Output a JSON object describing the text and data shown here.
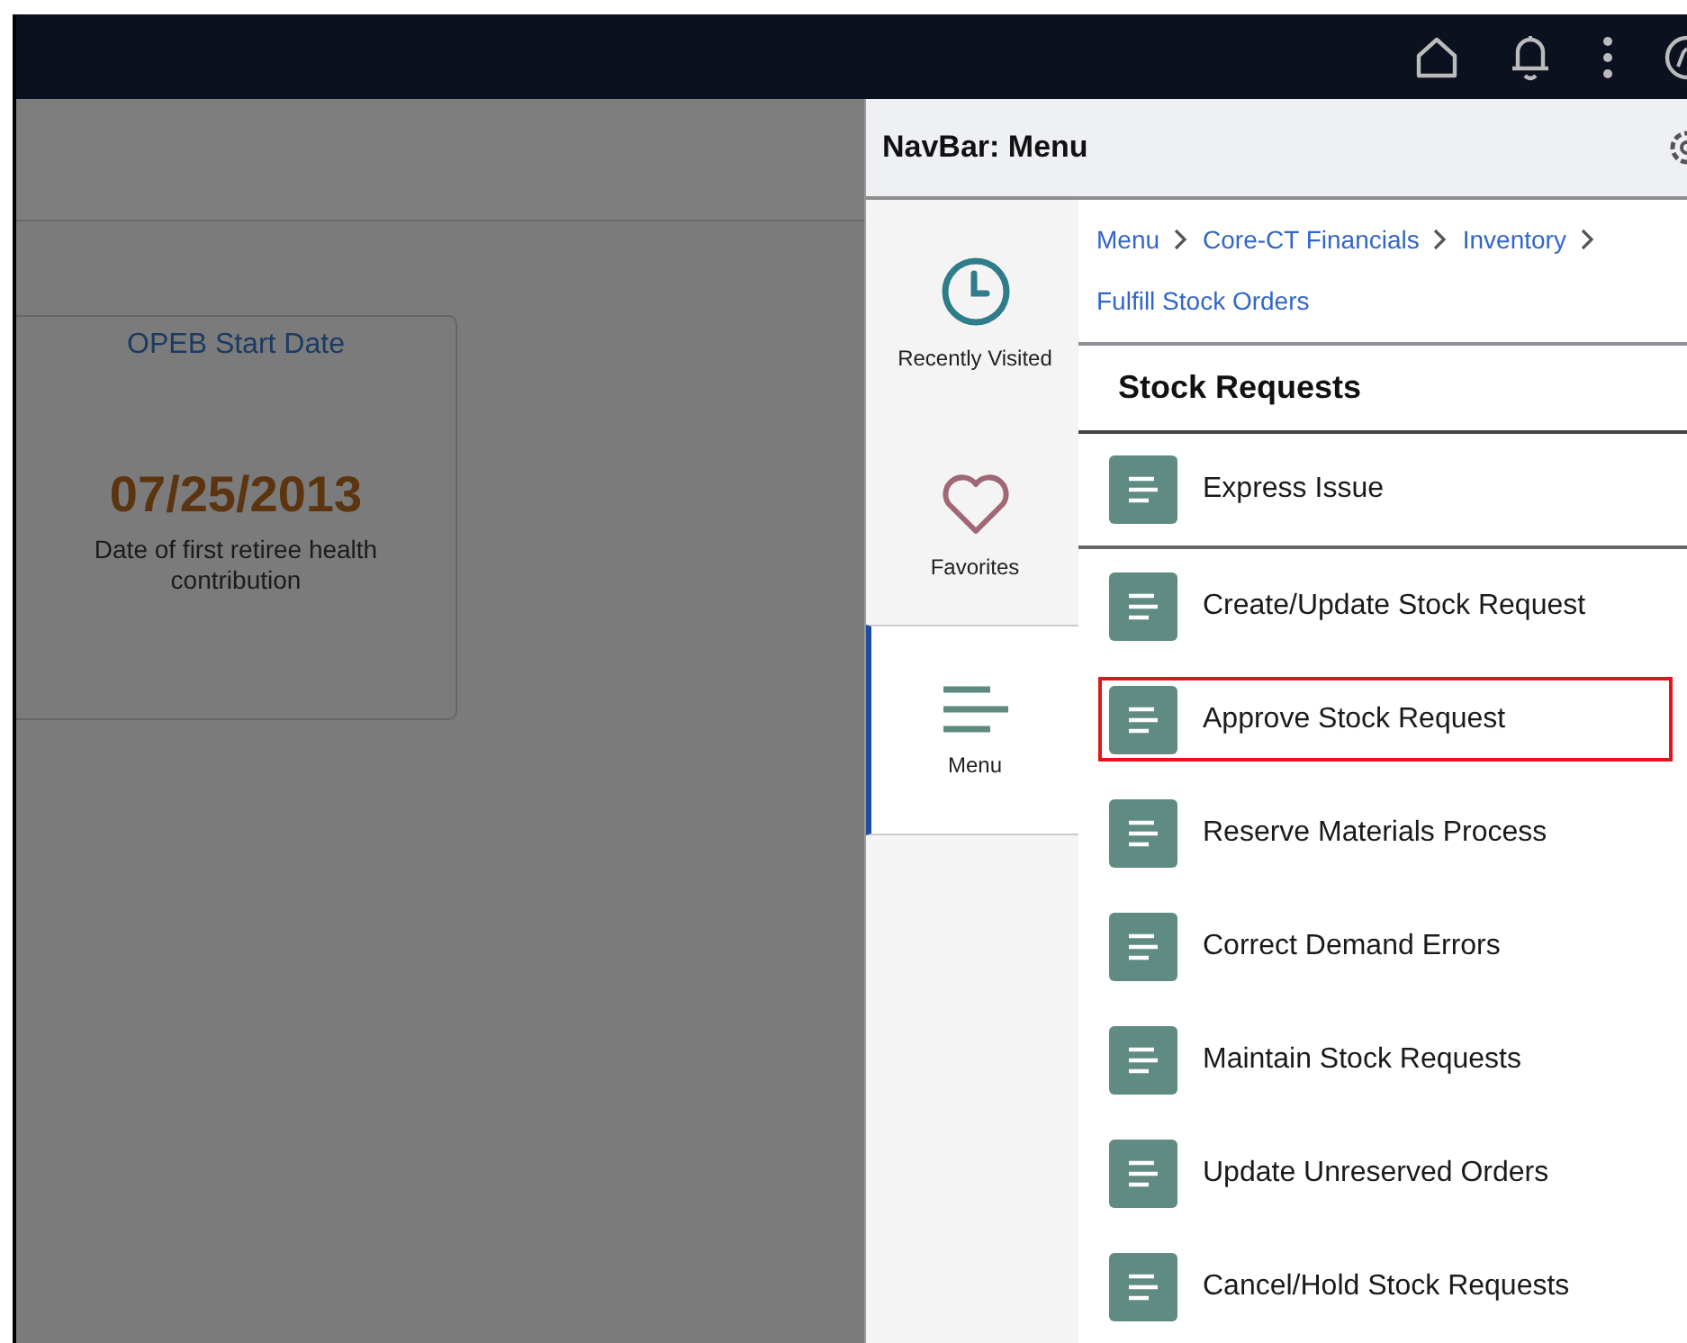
{
  "background_card": {
    "title": "OPEB Start Date",
    "value": "07/25/2013",
    "caption": "Date of first retiree health contribution"
  },
  "navbar": {
    "title": "NavBar: Menu",
    "rail": [
      {
        "kind": "clock",
        "label": "Recently Visited",
        "selected": false
      },
      {
        "kind": "heart",
        "label": "Favorites",
        "selected": false
      },
      {
        "kind": "menu",
        "label": "Menu",
        "selected": true
      }
    ],
    "breadcrumb": [
      "Menu",
      "Core-CT Financials",
      "Inventory",
      "Fulfill Stock Orders"
    ],
    "section": "Stock Requests",
    "items": [
      {
        "label": "Express Issue",
        "highlighted": false,
        "divider": true
      },
      {
        "label": "Create/Update Stock Request",
        "highlighted": false,
        "divider": false
      },
      {
        "label": "Approve Stock Request",
        "highlighted": true,
        "divider": false
      },
      {
        "label": "Reserve Materials Process",
        "highlighted": false,
        "divider": false
      },
      {
        "label": "Correct Demand Errors",
        "highlighted": false,
        "divider": false
      },
      {
        "label": "Maintain Stock Requests",
        "highlighted": false,
        "divider": false
      },
      {
        "label": "Update Unreserved Orders",
        "highlighted": false,
        "divider": false
      },
      {
        "label": "Cancel/Hold Stock Requests",
        "highlighted": false,
        "divider": false
      }
    ]
  }
}
